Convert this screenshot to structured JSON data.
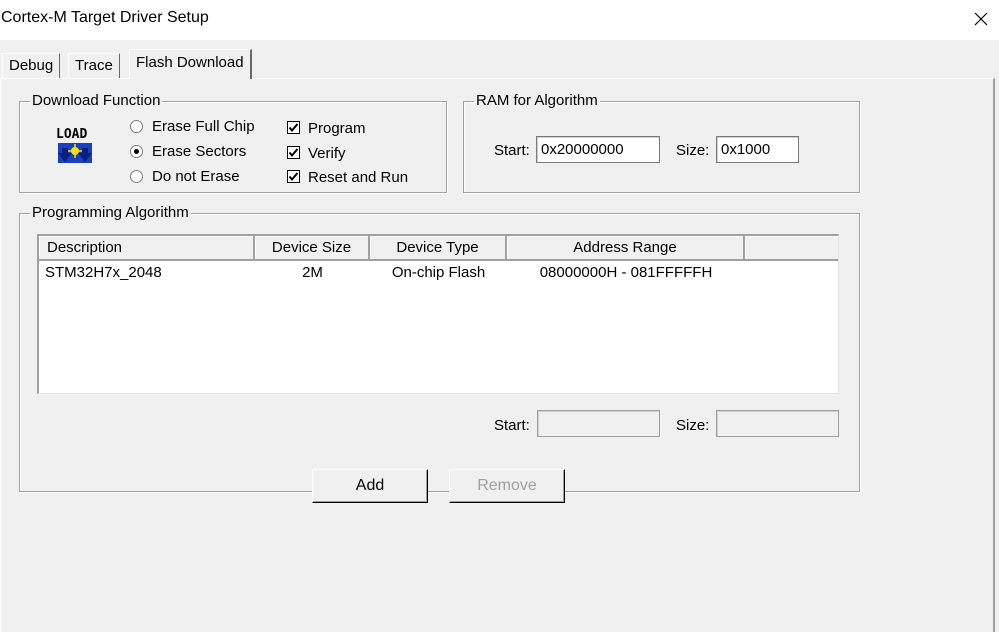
{
  "window": {
    "title": "Cortex-M Target Driver Setup"
  },
  "tabs": [
    {
      "label": "Debug"
    },
    {
      "label": "Trace"
    },
    {
      "label": "Flash Download"
    }
  ],
  "download_function": {
    "title": "Download Function",
    "icon": "load-icon",
    "erase_options": [
      {
        "label": "Erase Full Chip",
        "selected": false
      },
      {
        "label": "Erase Sectors",
        "selected": true
      },
      {
        "label": "Do not Erase",
        "selected": false
      }
    ],
    "checks": [
      {
        "label": "Program",
        "checked": true
      },
      {
        "label": "Verify",
        "checked": true
      },
      {
        "label": "Reset and Run",
        "checked": true
      }
    ]
  },
  "ram": {
    "title": "RAM for Algorithm",
    "start_label": "Start:",
    "start_value": "0x20000000",
    "size_label": "Size:",
    "size_value": "0x1000"
  },
  "programming_algorithm": {
    "title": "Programming Algorithm",
    "columns": [
      "Description",
      "Device Size",
      "Device Type",
      "Address Range"
    ],
    "rows": [
      {
        "description": "STM32H7x_2048",
        "device_size": "2M",
        "device_type": "On-chip Flash",
        "address_range": "08000000H - 081FFFFFH"
      }
    ],
    "start_label": "Start:",
    "start_value": "",
    "size_label": "Size:",
    "size_value": ""
  },
  "buttons": {
    "add": "Add",
    "remove": "Remove"
  },
  "colors": {
    "dialog_bg": "#f0f0f0",
    "border_dark": "#a0a0a0",
    "disabled_text": "#a0a0a0"
  }
}
